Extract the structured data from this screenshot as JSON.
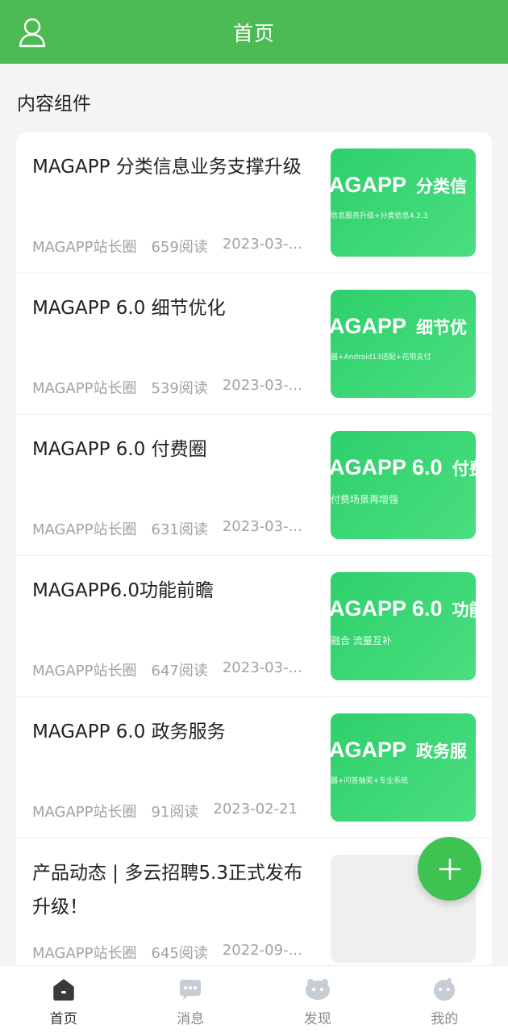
{
  "header": {
    "title": "首页",
    "user_icon": "user-icon"
  },
  "section": {
    "title": "内容组件"
  },
  "articles": [
    {
      "title": "MAGAPP 分类信息业务支撑升级",
      "author": "MAGAPP站长圈",
      "reads": "659阅读",
      "date": "2023-03-...",
      "thumb": {
        "big": "AGAPP",
        "cn": "分类信",
        "small": "信息服务升级+分类信息4.2.3"
      }
    },
    {
      "title": "MAGAPP 6.0 细节优化",
      "author": "MAGAPP站长圈",
      "reads": "539阅读",
      "date": "2023-03-...",
      "thumb": {
        "big": "AGAPP",
        "cn": "细节优",
        "small": "器+Android13适配+花呗支付"
      }
    },
    {
      "title": "MAGAPP 6.0 付费圈",
      "author": "MAGAPP站长圈",
      "reads": "631阅读",
      "date": "2023-03-...",
      "thumb": {
        "big": "AGAPP 6.0",
        "cn": "付费",
        "small": "付费场景再增强"
      }
    },
    {
      "title": "MAGAPP6.0功能前瞻",
      "author": "MAGAPP站长圈",
      "reads": "647阅读",
      "date": "2023-03-...",
      "thumb": {
        "big": "AGAPP 6.0",
        "cn": "功能",
        "small": "融合 流量互补"
      }
    },
    {
      "title": "MAGAPP 6.0 政务服务",
      "author": "MAGAPP站长圈",
      "reads": "91阅读",
      "date": "2023-02-21",
      "thumb": {
        "big": "AGAPP",
        "cn": "政务服",
        "small": "器+问答抽奖+专业系统"
      }
    },
    {
      "title": "产品动态 | 多云招聘5.3正式发布升级！",
      "author": "MAGAPP站长圈",
      "reads": "645阅读",
      "date": "2022-09-...",
      "thumb": null
    }
  ],
  "tabs": [
    {
      "label": "首页",
      "icon": "home-icon",
      "active": true
    },
    {
      "label": "消息",
      "icon": "message-icon",
      "active": false
    },
    {
      "label": "发现",
      "icon": "discover-icon",
      "active": false
    },
    {
      "label": "我的",
      "icon": "profile-icon",
      "active": false
    }
  ],
  "colors": {
    "brand": "#4dbb54",
    "fab": "#3ec353",
    "thumb": "#2ed06b"
  }
}
